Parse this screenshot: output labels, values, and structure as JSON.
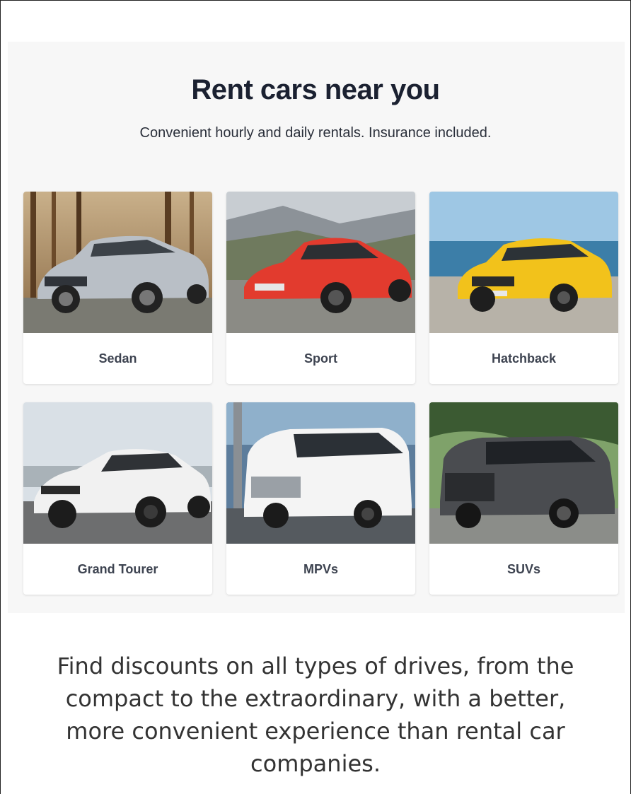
{
  "header": {
    "title": "Rent cars near you",
    "subtitle": "Convenient hourly and daily rentals. Insurance included."
  },
  "categories": [
    {
      "label": "Sedan",
      "image": "silver-sedan-in-forest",
      "car_color": "#b9bfc6"
    },
    {
      "label": "Sport",
      "image": "red-sports-coupe-on-mountain-road",
      "car_color": "#e23b2e"
    },
    {
      "label": "Hatchback",
      "image": "yellow-hatchback-by-ocean",
      "car_color": "#f2c21b"
    },
    {
      "label": "Grand Tourer",
      "image": "white-luxury-suv-coupe",
      "car_color": "#f1f1f1"
    },
    {
      "label": "MPVs",
      "image": "white-minivan-in-city",
      "car_color": "#f4f4f4"
    },
    {
      "label": "SUVs",
      "image": "dark-grey-suv-by-forest",
      "car_color": "#4a4c50"
    }
  ],
  "description": "Find discounts on all types of drives, from the compact to the extraordinary, with a better, more convenient experience than rental car companies."
}
